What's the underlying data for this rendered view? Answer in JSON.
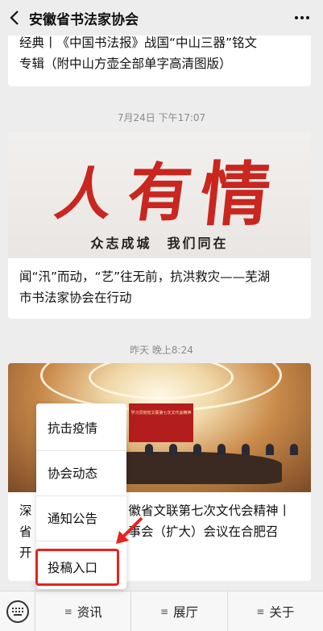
{
  "header": {
    "title": "安徽省书法家协会"
  },
  "articles": [
    {
      "title_line1": "经典丨《中国书法报》战国“中山三器”铭文",
      "title_line2": "专辑（附中山方壶全部单字高清图版）"
    },
    {
      "time": "7月24日 下午17:07",
      "banner_text": "众志成城　我们同在",
      "title_line1": "闻“汛”而动，“艺”往无前，抗洪救灾——芜湖",
      "title_line2": "市书法家协会在行动"
    },
    {
      "time": "昨天 晚上8:24",
      "title_line1": "深",
      "title_line1b": "徽省文联第七次文代会精神丨",
      "title_line2": "省",
      "title_line2b": "事会（扩大）会议在合肥召",
      "title_line3": "开"
    }
  ],
  "popup_menu": {
    "items": [
      {
        "label": "抗击疫情"
      },
      {
        "label": "协会动态"
      },
      {
        "label": "通知公告"
      },
      {
        "label": "投稿入口"
      }
    ],
    "highlight_color": "#e8231c"
  },
  "bottom_tabs": [
    {
      "label": "资讯"
    },
    {
      "label": "展厅"
    },
    {
      "label": "关于"
    }
  ]
}
